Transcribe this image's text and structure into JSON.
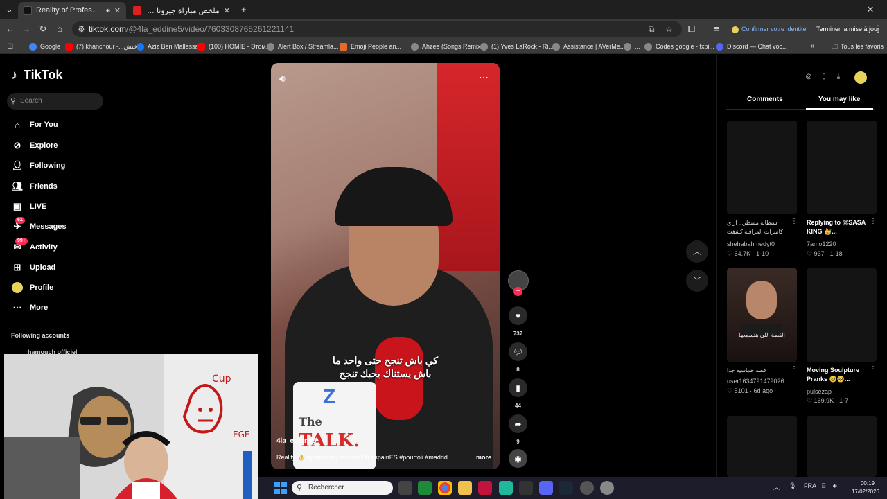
{
  "browser": {
    "tabs": [
      {
        "title": "Reality of Professional Boxing",
        "active": true
      },
      {
        "title": "ملخص مباراة جيرونا وبرشلونة | ال...",
        "active": false
      }
    ],
    "new_tab_glyph": "+",
    "url_host": "tiktok.com",
    "url_path": "/@4la_eddine5/video/7603308765261221141",
    "identity_label": "Confirmer votre identité",
    "update_label": "Terminer la mise à jour",
    "bookmarks": [
      {
        "label": "Google",
        "color": "#4285f4"
      },
      {
        "label": "(7) khanchour -...خنش",
        "color": "#ff0000"
      },
      {
        "label": "Aziz Ben Mallessa",
        "color": "#1877f2"
      },
      {
        "label": "(100) HOMIE - Этом...",
        "color": "#ff0000"
      },
      {
        "label": "Alert Box / Streamla...",
        "color": "#888888"
      },
      {
        "label": "Emoji People an...",
        "color": "#e66a2c"
      },
      {
        "label": "Ahzee (Songs Remix...",
        "color": "#888888"
      },
      {
        "label": "(1) Yves LaRock - Ri...",
        "color": "#888888"
      },
      {
        "label": "Assistance | AVerMe...",
        "color": "#888888"
      },
      {
        "label": "...",
        "color": "#888888"
      },
      {
        "label": "Codes google - fxpi...",
        "color": "#888888"
      },
      {
        "label": "Discord — Chat voc...",
        "color": "#5865f2"
      }
    ],
    "all_bookmarks_label": "Tous les favoris"
  },
  "sidebar": {
    "logo": "TikTok",
    "search_placeholder": "Search",
    "nav": [
      {
        "label": "For You",
        "icon": "home-icon"
      },
      {
        "label": "Explore",
        "icon": "compass-icon"
      },
      {
        "label": "Following",
        "icon": "following-icon"
      },
      {
        "label": "Friends",
        "icon": "friends-icon"
      },
      {
        "label": "LIVE",
        "icon": "live-icon"
      },
      {
        "label": "Messages",
        "icon": "messages-icon",
        "badge": "61"
      },
      {
        "label": "Activity",
        "icon": "activity-icon",
        "badge": "99+"
      },
      {
        "label": "Upload",
        "icon": "upload-icon"
      },
      {
        "label": "Profile",
        "icon": "profile-icon"
      },
      {
        "label": "More",
        "icon": "more-icon"
      }
    ],
    "following_accounts_label": "Following accounts",
    "following_account": "hamouch officiel"
  },
  "video": {
    "subtitle_line1": "كي باش تنجح حتى واحد ما",
    "subtitle_line2": "باش يستناك يحبك تنجح",
    "mug_text": "The",
    "mug_text2": "TALK.",
    "mug_z": "Z",
    "author": "4la_eddine5",
    "caption": "Reality 👌 #proboxing #tunisiaTN #spainES #pourtoii #madrid",
    "more_label": "more",
    "likes": "737",
    "comments": "8",
    "saves": "44",
    "shares": "9"
  },
  "right_panel": {
    "tab_comments": "Comments",
    "tab_you_may_like": "You may like",
    "cards": [
      {
        "title": "شيطانة مسطر... ازاي كاميرات المراقبة كشفت",
        "rtl": true,
        "user": "shehabahmedyt0",
        "meta": "♡ 64.7K · 1-10"
      },
      {
        "title": "Replying to @SASA KING 👑...",
        "rtl": false,
        "user": "7amo1220",
        "meta": "♡ 937 · 1-18"
      },
      {
        "title": "قصه حماسيه جدا",
        "rtl": true,
        "user": "user1634791479026",
        "meta": "♡ 5101 · 6d ago",
        "thumb_caption": "القصة اللي هتسمعها"
      },
      {
        "title": "Moving Soulpture Pranks 🥺🥺...",
        "rtl": false,
        "user": "pulsezap",
        "meta": "♡ 169.9K · 1-7"
      }
    ]
  },
  "taskbar": {
    "search_placeholder": "Rechercher",
    "lang": "FRA",
    "time": "00:19",
    "date": "17/02/2026"
  },
  "colors": {
    "tiktok_red": "#fe2c55",
    "background": "#000000",
    "chrome_toolbar": "#3a3a3a"
  }
}
